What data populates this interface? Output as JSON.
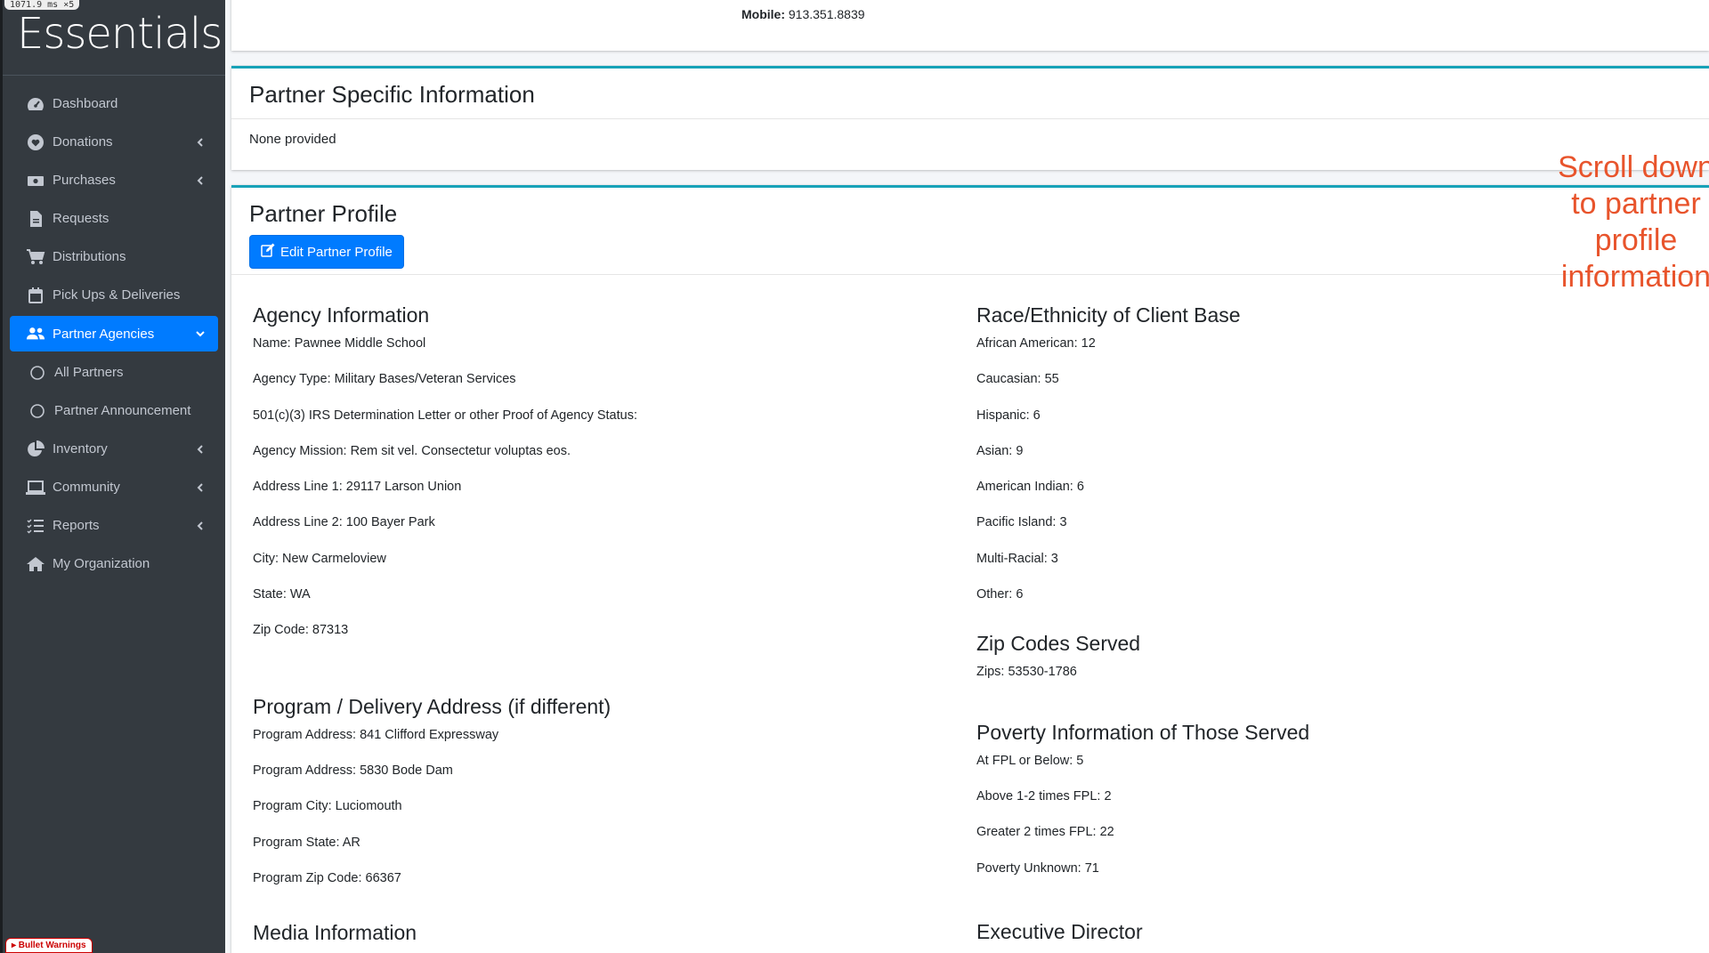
{
  "debug": {
    "perf_badge": "1071.9 ms ×5",
    "bullet_warnings": "▸ Bullet Warnings"
  },
  "brand": {
    "name": "Essentials"
  },
  "sidebar": {
    "items": [
      {
        "label": "Dashboard",
        "icon": "tachometer-icon"
      },
      {
        "label": "Donations",
        "icon": "heart-icon"
      },
      {
        "label": "Purchases",
        "icon": "money-icon"
      },
      {
        "label": "Requests",
        "icon": "file-icon"
      },
      {
        "label": "Distributions",
        "icon": "cart-icon"
      },
      {
        "label": "Pick Ups & Deliveries",
        "icon": "calendar-icon"
      },
      {
        "label": "Partner Agencies",
        "icon": "users-icon"
      },
      {
        "label": "All Partners",
        "icon": "circle-icon"
      },
      {
        "label": "Partner Announcement",
        "icon": "circle-icon"
      },
      {
        "label": "Inventory",
        "icon": "pie-chart-icon"
      },
      {
        "label": "Community",
        "icon": "laptop-icon"
      },
      {
        "label": "Reports",
        "icon": "list-icon"
      },
      {
        "label": "My Organization",
        "icon": "home-icon"
      }
    ],
    "active_color": "#007bff"
  },
  "contact": {
    "mobile_label": "Mobile:",
    "mobile_value": "913.351.8839"
  },
  "partner_specific": {
    "title": "Partner Specific Information",
    "body": "None provided"
  },
  "profile": {
    "title": "Partner Profile",
    "edit_button": "Edit Partner Profile",
    "agency": {
      "title": "Agency Information",
      "fields": [
        "Name: Pawnee Middle School",
        "Agency Type: Military Bases/Veteran Services",
        "501(c)(3) IRS Determination Letter or other Proof of Agency Status:",
        "Agency Mission: Rem sit vel. Consectetur voluptas eos.",
        "Address Line 1: 29117 Larson Union",
        "Address Line 2: 100 Bayer Park",
        "City: New Carmeloview",
        "State: WA",
        "Zip Code: 87313"
      ]
    },
    "program": {
      "title": "Program / Delivery Address (if different)",
      "fields": [
        "Program Address: 841 Clifford Expressway",
        "Program Address: 5830 Bode Dam",
        "Program City: Luciomouth",
        "Program State: AR",
        "Program Zip Code: 66367"
      ]
    },
    "media": {
      "title": "Media Information"
    },
    "race": {
      "title": "Race/Ethnicity of Client Base",
      "fields": [
        "African American: 12",
        "Caucasian: 55",
        "Hispanic: 6",
        "Asian: 9",
        "American Indian: 6",
        "Pacific Island: 3",
        "Multi-Racial: 3",
        "Other: 6"
      ]
    },
    "zips": {
      "title": "Zip Codes Served",
      "fields": [
        "Zips: 53530-1786"
      ]
    },
    "poverty": {
      "title": "Poverty Information of Those Served",
      "fields": [
        "At FPL or Below: 5",
        "Above 1-2 times FPL: 2",
        "Greater 2 times FPL: 22",
        "Poverty Unknown: 71"
      ]
    },
    "director": {
      "title": "Executive Director"
    }
  },
  "annotation": {
    "text_lines": [
      "Scroll down",
      "to partner",
      "profile",
      "information"
    ],
    "color": "#e8542c"
  }
}
